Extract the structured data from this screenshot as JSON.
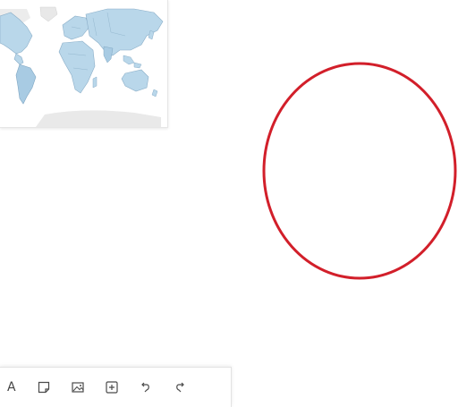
{
  "map": {
    "land_color": "#b9d7ea",
    "border_color": "#8aaec8",
    "ice_color": "#e6e6e6"
  },
  "shape": {
    "type": "ellipse",
    "stroke_color": "#d21f2a",
    "fill": "none"
  },
  "toolbar": {
    "text_tool_glyph": "A",
    "tools": [
      {
        "name": "text-tool",
        "icon": "text-icon"
      },
      {
        "name": "sticky-note-tool",
        "icon": "sticky-note-icon"
      },
      {
        "name": "image-tool",
        "icon": "image-icon"
      },
      {
        "name": "add-tool",
        "icon": "plus-box-icon"
      },
      {
        "name": "undo-tool",
        "icon": "undo-icon"
      },
      {
        "name": "redo-tool",
        "icon": "redo-icon"
      }
    ]
  }
}
